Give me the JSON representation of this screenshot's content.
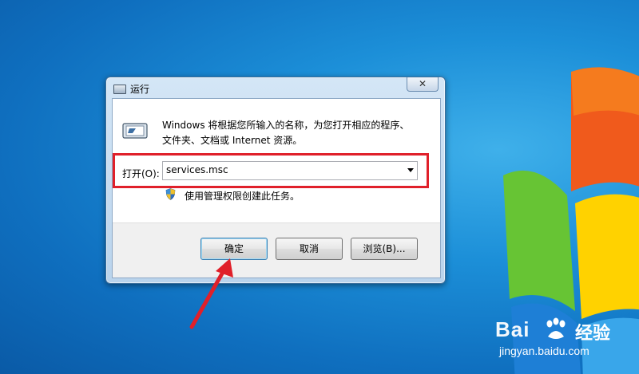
{
  "dialog": {
    "title": "运行",
    "close_label": "✕",
    "description_line1": "Windows 将根据您所输入的名称，为您打开相应的程序、",
    "description_line2": "文件夹、文档或 Internet 资源。",
    "open_label": "打开(O):",
    "open_value": "services.msc",
    "admin_note": "使用管理权限创建此任务。",
    "buttons": {
      "ok": "确定",
      "cancel": "取消",
      "browse": "浏览(B)..."
    }
  },
  "watermark": {
    "brand_left": "Bai",
    "brand_right": "经验",
    "url": "jingyan.baidu.com"
  },
  "colors": {
    "highlight": "#e0202a",
    "desktop": "#1c8fd8"
  },
  "icons": [
    "run-icon",
    "shield-icon",
    "close-icon",
    "chevron-down-icon",
    "windows-logo"
  ]
}
